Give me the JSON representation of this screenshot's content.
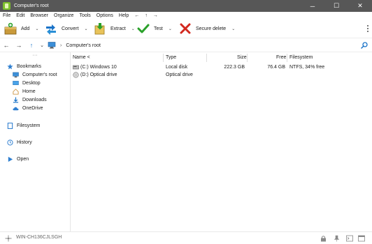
{
  "window": {
    "title": "Computer's root",
    "minimize": "─",
    "maximize": "☐",
    "close": "✕"
  },
  "menu": [
    "File",
    "Edit",
    "Browser",
    "Organize",
    "Tools",
    "Options",
    "Help",
    "←",
    "↑",
    "→"
  ],
  "toolbar": {
    "add": "Add",
    "convert": "Convert",
    "extract": "Extract",
    "test": "Test",
    "secure_delete": "Secure delete",
    "caret": "⌄"
  },
  "address": {
    "back": "←",
    "forward": "→",
    "up": "↑",
    "history_caret": "⌄",
    "separator": "›",
    "path": "Computer's root"
  },
  "sidebar": {
    "more": "···",
    "bookmarks": "Bookmarks",
    "items": [
      "Computer's root",
      "Desktop",
      "Home",
      "Downloads",
      "OneDrive"
    ],
    "filesystem": "Filesystem",
    "history": "History",
    "open": "Open"
  },
  "table": {
    "columns": {
      "name": "Name <",
      "type": "Type",
      "size": "Size",
      "free": "Free",
      "filesystem": "Filesystem"
    },
    "rows": [
      {
        "name": "(C:) Windows 10",
        "type": "Local disk",
        "size": "222.3 GB",
        "free": "76.4 GB",
        "filesystem": "NTFS, 34% free"
      },
      {
        "name": "(D:) Optical drive",
        "type": "Optical drive",
        "size": "",
        "free": "",
        "filesystem": ""
      }
    ]
  },
  "status": {
    "computer_name": "WIN-CH136CJLSGH"
  },
  "colors": {
    "titlebar": "#575757",
    "accent_blue": "#1a73c8",
    "check_green": "#2aa12a",
    "delete_red": "#d2281e"
  }
}
